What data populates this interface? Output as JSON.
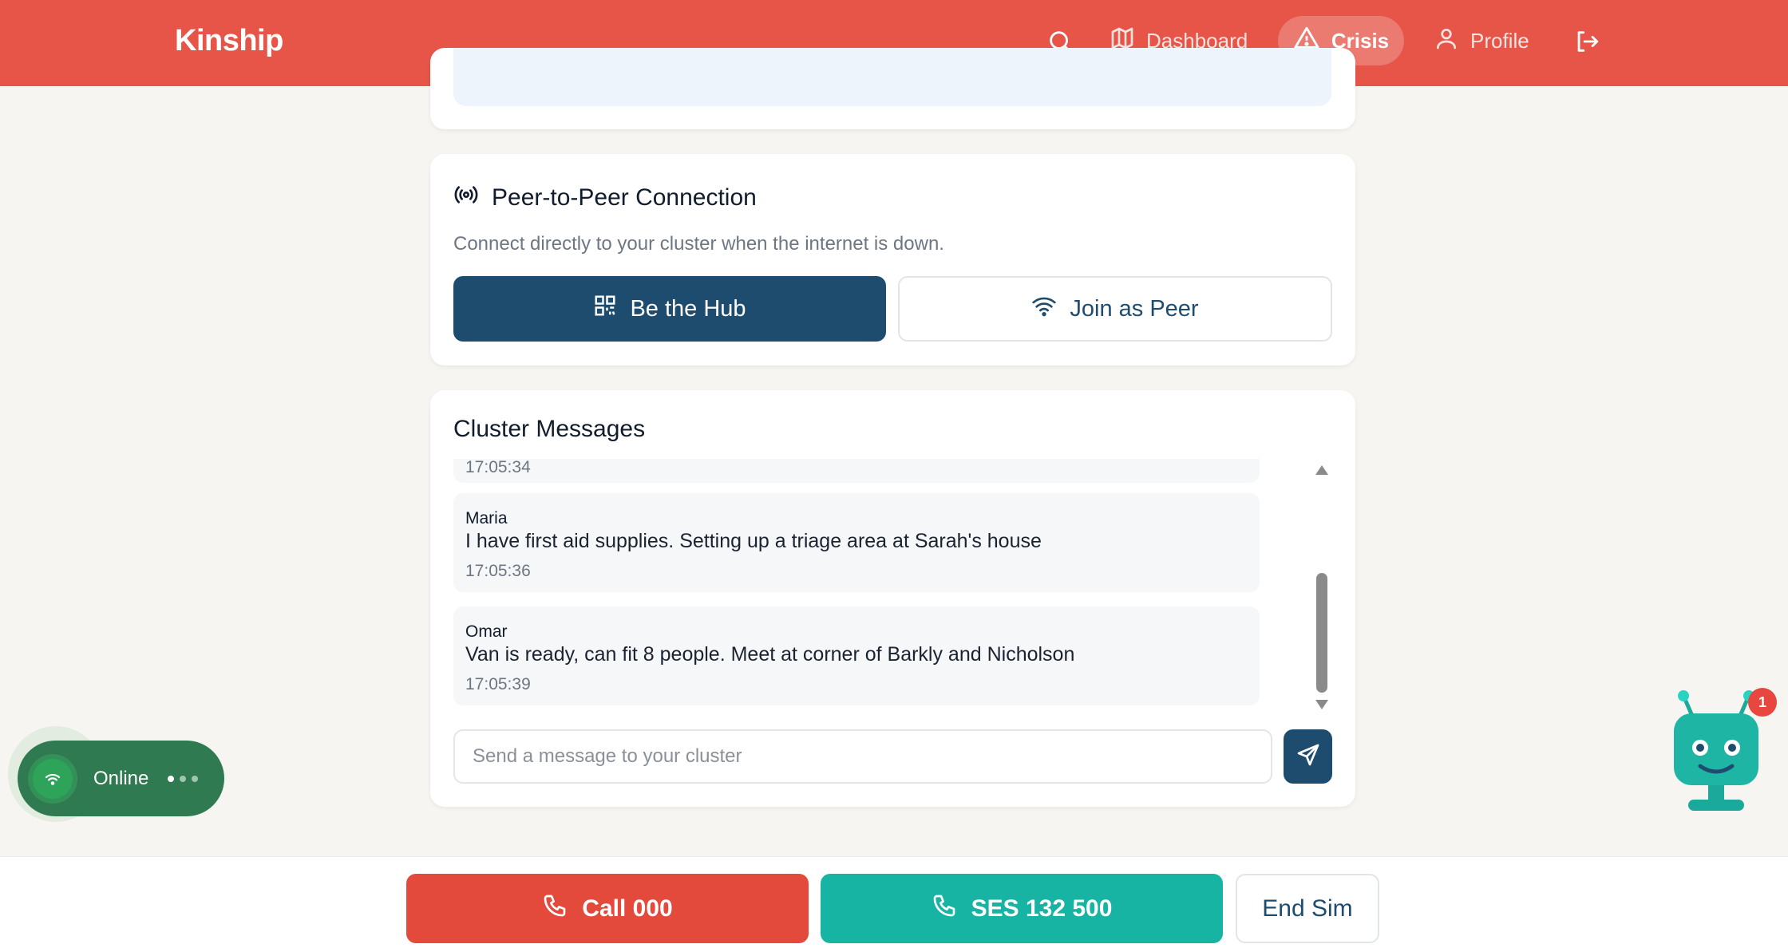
{
  "header": {
    "brand": "Kinship",
    "nav": {
      "dashboard": "Dashboard",
      "crisis": "Crisis",
      "profile": "Profile"
    }
  },
  "p2p": {
    "title": "Peer-to-Peer Connection",
    "description": "Connect directly to your cluster when the internet is down.",
    "hub_button": "Be the Hub",
    "peer_button": "Join as Peer"
  },
  "cluster": {
    "title": "Cluster Messages",
    "partial_time": "17:05:34",
    "messages": [
      {
        "author": "Maria",
        "text": "I have first aid supplies. Setting up a triage area at Sarah's house",
        "time": "17:05:36"
      },
      {
        "author": "Omar",
        "text": "Van is ready, can fit 8 people. Meet at corner of Barkly and Nicholson",
        "time": "17:05:39"
      }
    ],
    "input_placeholder": "Send a message to your cluster"
  },
  "bottom": {
    "call": "Call 000",
    "ses": "SES 132 500",
    "end": "End Sim"
  },
  "status": {
    "label": "Online"
  },
  "assistant": {
    "badge_count": "1"
  },
  "colors": {
    "header": "#e65548",
    "primary": "#1e4c6f",
    "call": "#e44a3c",
    "ses": "#17b3a3",
    "online": "#2f7a50"
  }
}
